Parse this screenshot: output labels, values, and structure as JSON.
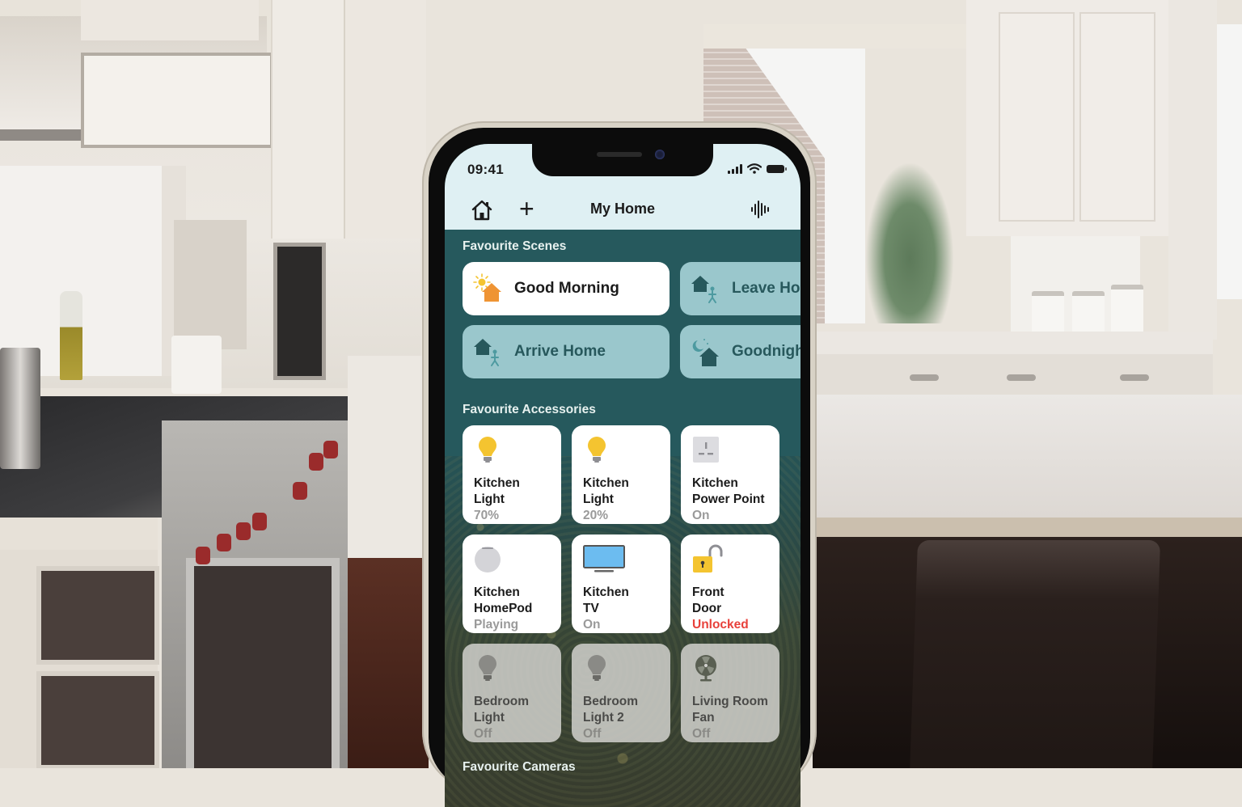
{
  "status_bar": {
    "time": "09:41",
    "icons": [
      "cellular-signal-icon",
      "wifi-icon",
      "battery-icon"
    ]
  },
  "nav": {
    "home_icon": "home-icon",
    "add_icon": "plus-icon",
    "add_label": "+",
    "title": "My Home",
    "voice_icon": "siri-waveform-icon"
  },
  "sections": {
    "scenes": "Favourite Scenes",
    "accessories": "Favourite Accessories",
    "cameras": "Favourite Cameras"
  },
  "scenes": [
    {
      "label": "Good Morning",
      "icon": "sun-house-icon",
      "active": true
    },
    {
      "label": "Leave Home",
      "icon": "house-person-leaving-icon",
      "active": false
    },
    {
      "label": "Arrive Home",
      "icon": "house-person-arriving-icon",
      "active": false
    },
    {
      "label": "Goodnight",
      "icon": "moon-house-icon",
      "active": false
    }
  ],
  "accessories": [
    {
      "name_line1": "Kitchen",
      "name_line2": "Light",
      "status": "70%",
      "icon": "lightbulb-on-icon",
      "state": "on"
    },
    {
      "name_line1": "Kitchen",
      "name_line2": "Light",
      "status": "20%",
      "icon": "lightbulb-on-icon",
      "state": "on"
    },
    {
      "name_line1": "Kitchen",
      "name_line2": "Power Point",
      "status": "On",
      "icon": "power-outlet-icon",
      "state": "on"
    },
    {
      "name_line1": "Kitchen",
      "name_line2": "HomePod",
      "status": "Playing",
      "icon": "homepod-icon",
      "state": "on"
    },
    {
      "name_line1": "Kitchen",
      "name_line2": "TV",
      "status": "On",
      "icon": "tv-icon",
      "state": "on"
    },
    {
      "name_line1": "Front",
      "name_line2": "Door",
      "status": "Unlocked",
      "icon": "lock-open-icon",
      "state": "on",
      "alert": true
    },
    {
      "name_line1": "Bedroom",
      "name_line2": "Light",
      "status": "Off",
      "icon": "lightbulb-off-icon",
      "state": "off"
    },
    {
      "name_line1": "Bedroom",
      "name_line2": "Light 2",
      "status": "Off",
      "icon": "lightbulb-off-icon",
      "state": "off"
    },
    {
      "name_line1": "Living Room",
      "name_line2": "Fan",
      "status": "Off",
      "icon": "fan-icon",
      "state": "off"
    }
  ],
  "colors": {
    "accent_teal": "#26595d",
    "scene_inactive": "#9ac7cc",
    "alert_red": "#e8413b",
    "bulb_yellow": "#f4c430",
    "sun_orange": "#ef9433"
  }
}
